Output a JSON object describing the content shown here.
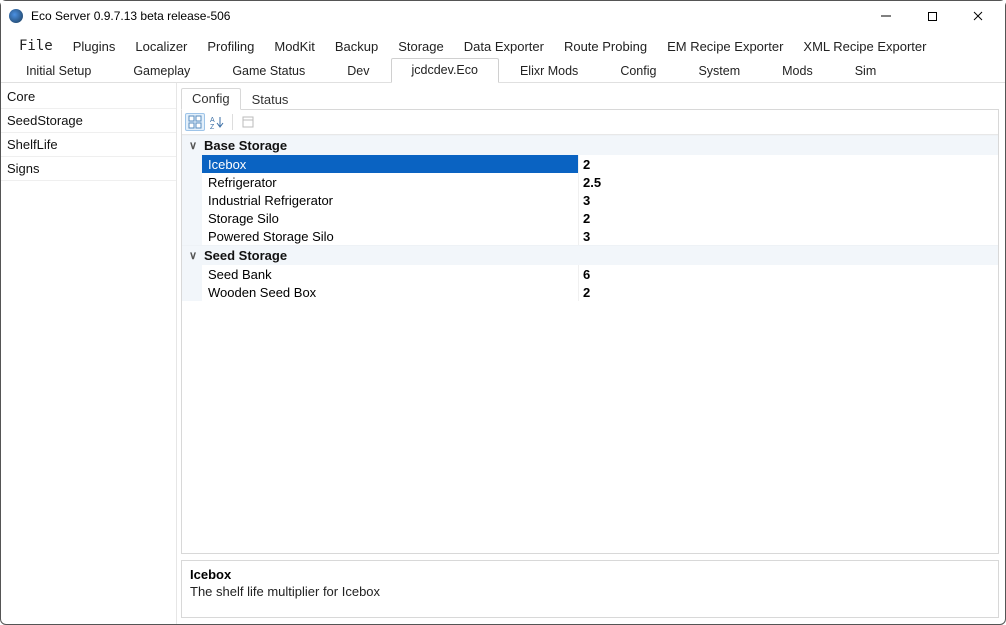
{
  "window": {
    "title": "Eco Server 0.9.7.13 beta release-506"
  },
  "menus": {
    "file": "File",
    "plugins": "Plugins",
    "localizer": "Localizer",
    "profiling": "Profiling",
    "modkit": "ModKit",
    "backup": "Backup",
    "storage": "Storage",
    "data_exporter": "Data Exporter",
    "route_probing": "Route Probing",
    "em_recipe": "EM Recipe Exporter",
    "xml_recipe": "XML Recipe Exporter"
  },
  "tabs": {
    "initial_setup": "Initial Setup",
    "gameplay": "Gameplay",
    "game_status": "Game Status",
    "dev": "Dev",
    "jcdcdev": "jcdcdev.Eco",
    "elixr": "Elixr Mods",
    "config": "Config",
    "system": "System",
    "mods": "Mods",
    "sim": "Sim"
  },
  "sidebar": {
    "items": [
      "Core",
      "SeedStorage",
      "ShelfLife",
      "Signs"
    ]
  },
  "inner_tabs": {
    "config": "Config",
    "status": "Status"
  },
  "groups": [
    {
      "name": "Base Storage",
      "rows": [
        {
          "name": "Icebox",
          "value": "2",
          "selected": true
        },
        {
          "name": "Refrigerator",
          "value": "2.5"
        },
        {
          "name": "Industrial Refrigerator",
          "value": "3"
        },
        {
          "name": "Storage Silo",
          "value": "2"
        },
        {
          "name": "Powered Storage Silo",
          "value": "3"
        }
      ]
    },
    {
      "name": "Seed Storage",
      "rows": [
        {
          "name": "Seed Bank",
          "value": "6"
        },
        {
          "name": "Wooden Seed Box",
          "value": "2"
        }
      ]
    }
  ],
  "description": {
    "title": "Icebox",
    "text": "The shelf life multiplier for Icebox"
  }
}
